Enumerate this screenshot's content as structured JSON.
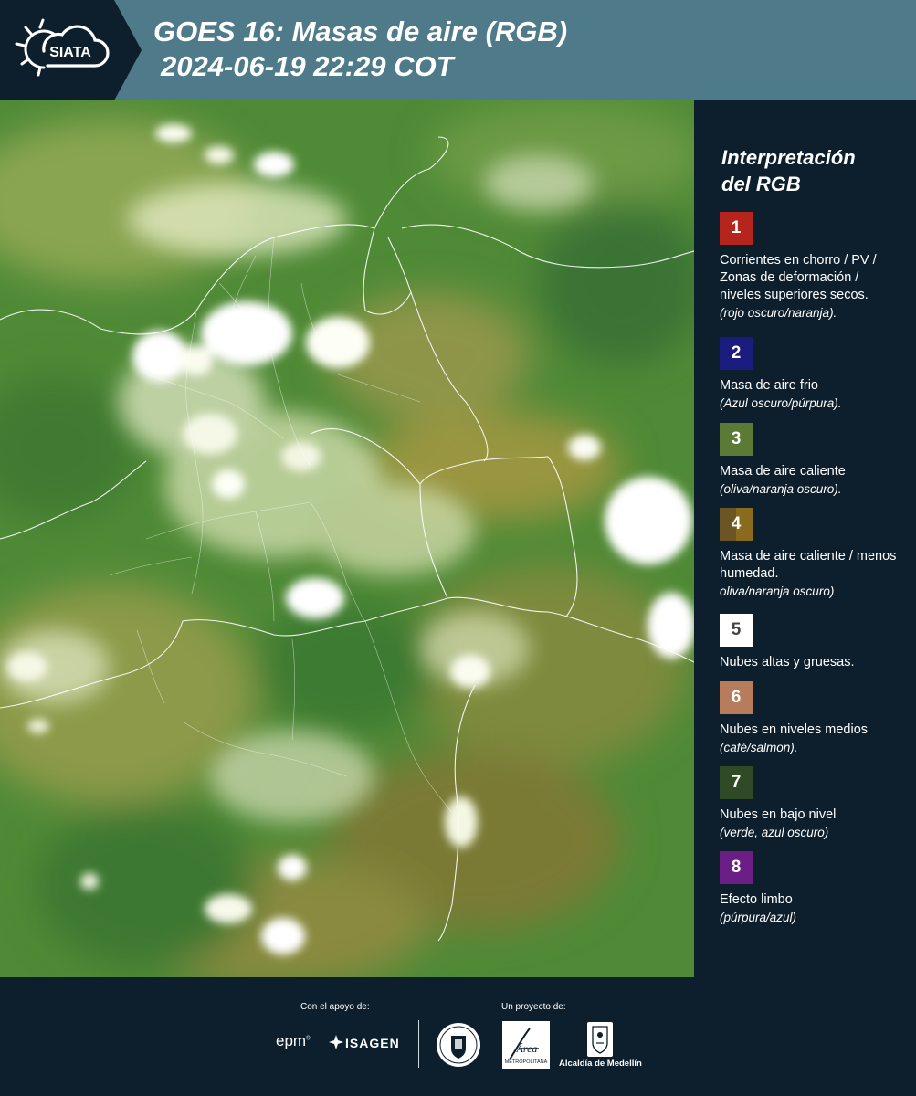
{
  "header": {
    "logo_text": "SIATA",
    "title_line1": "GOES 16: Masas de aire (RGB)",
    "title_line2": "2024-06-19 22:29 COT"
  },
  "legend": {
    "title_line1": "Interpretación",
    "title_line2": "del RGB",
    "items": [
      {
        "number": "1",
        "color": "#b5251d",
        "text": "Corrientes en chorro / PV / Zonas de deformación / niveles superiores secos.",
        "note": "(rojo oscuro/naranja)."
      },
      {
        "number": "2",
        "color": "#1a1d7e",
        "text": "Masa de aire frio",
        "note": "(Azul oscuro/púrpura)."
      },
      {
        "number": "3",
        "color": "#5a7a35",
        "text": "Masa de aire caliente",
        "note": "(oliva/naranja oscuro)."
      },
      {
        "number": "4",
        "color": "#6b5524",
        "color2": "#8a6a1c",
        "text": "Masa de aire caliente / menos humedad.",
        "note": "oliva/naranja oscuro)"
      },
      {
        "number": "5",
        "color": "#ffffff",
        "text_color": "#444444",
        "text": "Nubes altas y gruesas.",
        "note": ""
      },
      {
        "number": "6",
        "color": "#b77c5b",
        "text": "Nubes en niveles medios",
        "note": "(café/salmon)."
      },
      {
        "number": "7",
        "color": "#2f4a25",
        "text": "Nubes en bajo nivel",
        "note": "(verde, azul oscuro)"
      },
      {
        "number": "8",
        "color": "#6b1f86",
        "text": "Efecto limbo",
        "note": "(púrpura/azul)"
      }
    ]
  },
  "footer": {
    "support_label": "Con el apoyo de:",
    "project_label": "Un proyecto de:",
    "epm": "epm",
    "isagen": "ISAGEN",
    "metro_name": "Área",
    "metro_sub": "METROPOLITANA",
    "alcaldia": "Alcaldía de Medellín"
  },
  "icons": {
    "siata_logo": "sun-cloud-icon",
    "isagen_logo": "star-icon",
    "university_seal": "seal-icon",
    "metropolitana_logo": "area-metropolitana-icon",
    "alcaldia_logo": "coat-of-arms-icon"
  }
}
